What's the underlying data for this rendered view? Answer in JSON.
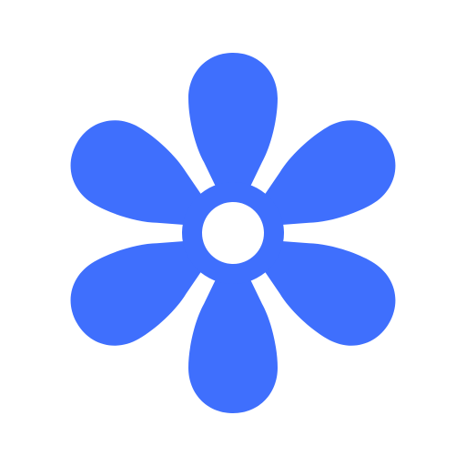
{
  "icon": {
    "name": "flower-icon",
    "petal_count": 6,
    "fill_color": "#3f6ffd",
    "center_color": "#ffffff",
    "background_color": "#ffffff"
  }
}
